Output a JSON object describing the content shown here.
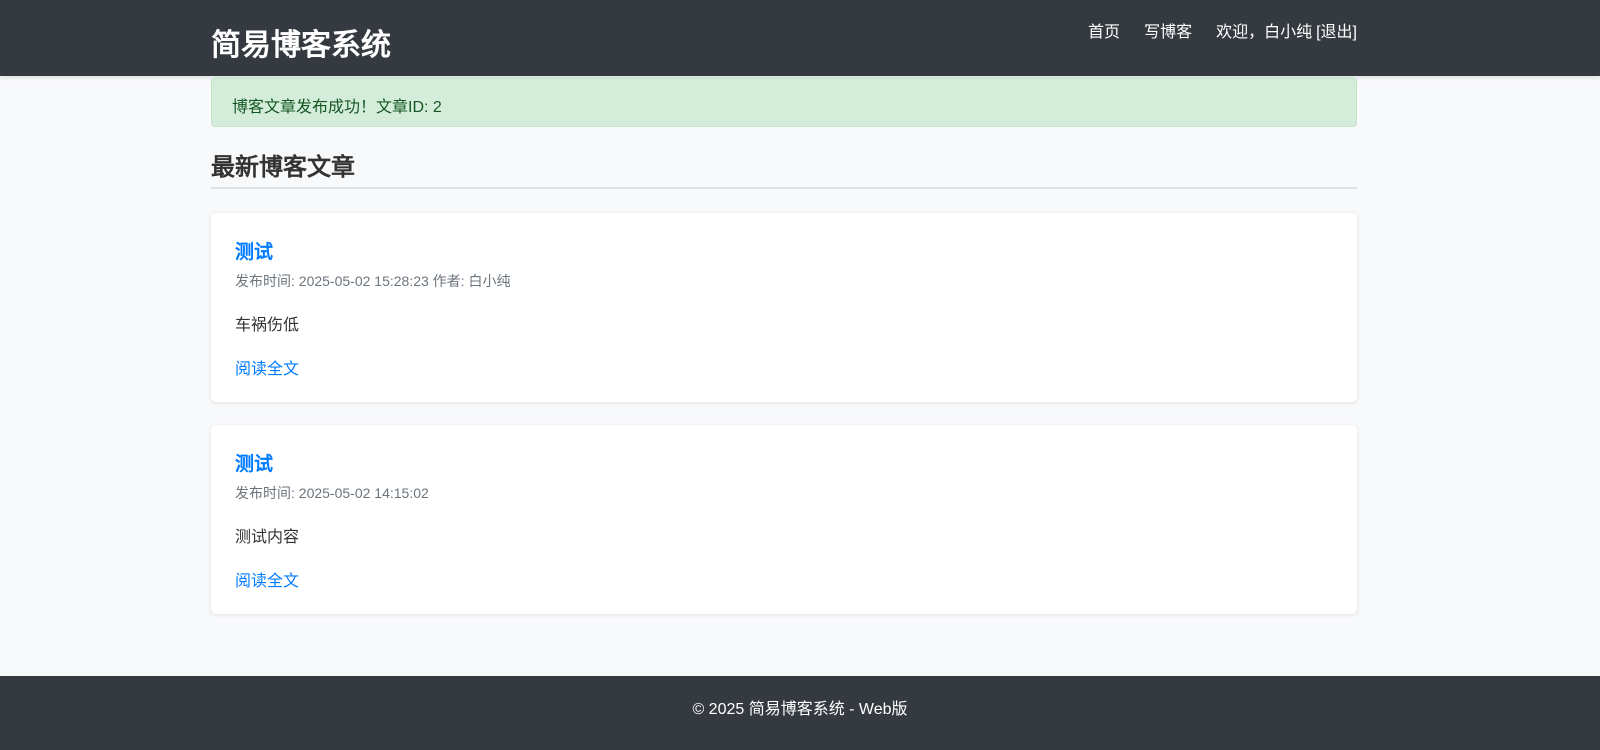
{
  "header": {
    "logo": "简易博客系统",
    "nav": {
      "home": "首页",
      "write": "写博客",
      "welcome": "欢迎，白小纯",
      "logout": "[退出]"
    }
  },
  "alert": {
    "text": "博客文章发布成功！文章ID: 2"
  },
  "section_title": "最新博客文章",
  "posts": [
    {
      "title": "测试",
      "meta": "发布时间: 2025-05-02 15:28:23 作者: 白小纯",
      "excerpt": "车祸伤低",
      "read_more": "阅读全文"
    },
    {
      "title": "测试",
      "meta": "发布时间: 2025-05-02 14:15:02",
      "excerpt": "测试内容",
      "read_more": "阅读全文"
    }
  ],
  "footer": {
    "text": "© 2025 简易博客系统 - Web版"
  },
  "colors": {
    "header": "#343a40",
    "accent": "#007bff",
    "success_bg": "#d4edda"
  }
}
